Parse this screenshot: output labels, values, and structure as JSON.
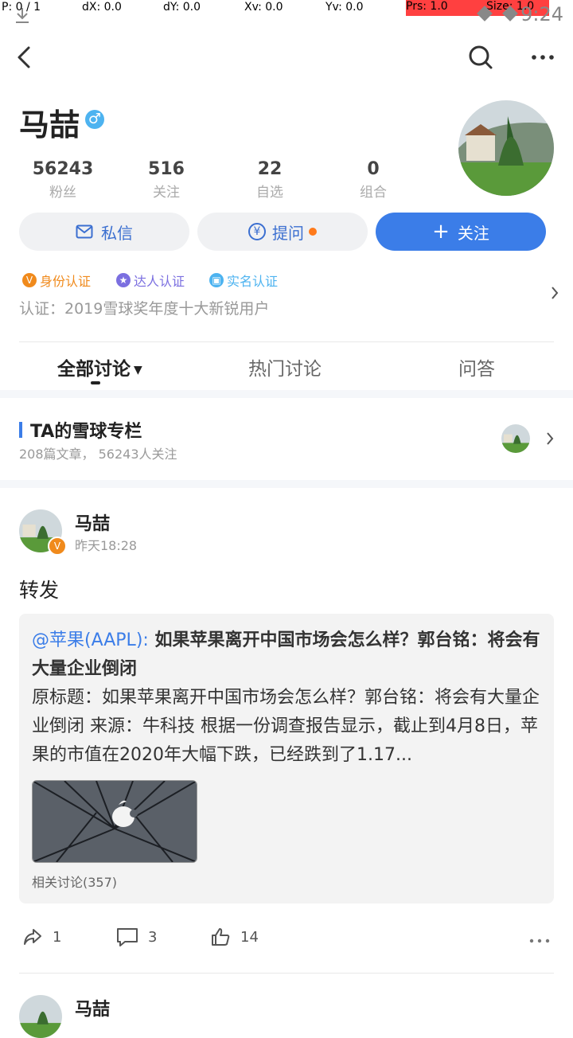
{
  "debug": {
    "p": "P: 0 / 1",
    "dx": "dX: 0.0",
    "dy": "dY: 0.0",
    "xv": "Xv: 0.0",
    "yv": "Yv: 0.0",
    "prs": "Prs: 1.0",
    "size": "Size: 1.0"
  },
  "status_bar": {
    "time": "9:24"
  },
  "profile": {
    "name": "马喆",
    "stats": [
      {
        "value": "56243",
        "label": "粉丝"
      },
      {
        "value": "516",
        "label": "关注"
      },
      {
        "value": "22",
        "label": "自选"
      },
      {
        "value": "0",
        "label": "组合"
      }
    ],
    "buttons": {
      "message": "私信",
      "ask": "提问",
      "follow": "关注"
    },
    "badges": [
      {
        "icon": "V",
        "label": "身份认证",
        "color": "#f08a1c"
      },
      {
        "icon": "★",
        "label": "达人认证",
        "color": "#7b6fe0"
      },
      {
        "icon": "▣",
        "label": "实名认证",
        "color": "#4db3f0"
      }
    ],
    "certification": "认证：2019雪球奖年度十大新锐用户"
  },
  "tabs": [
    "全部讨论",
    "热门讨论",
    "问答"
  ],
  "column": {
    "title": "TA的雪球专栏",
    "subtitle": "208篇文章， 56243人关注"
  },
  "post": {
    "author": "马喆",
    "time": "昨天18:28",
    "body": "转发",
    "quote": {
      "mention": "@苹果(AAPL):",
      "title": " 如果苹果离开中国市场会怎么样？郭台铭：将会有大量企业倒闭",
      "text": "原标题：如果苹果离开中国市场会怎么样？郭台铭：将会有大量企业倒闭 来源：牛科技 根据一份调查报告显示，截止到4月8日，苹果的市值在2020年大幅下跌，已经跌到了1.17...",
      "related": "相关讨论(357)"
    },
    "actions": {
      "repost": "1",
      "comment": "3",
      "like": "14"
    }
  },
  "next_post": {
    "author": "马喆"
  },
  "colors": {
    "accent": "#3b7de8",
    "orange": "#f08a1c"
  }
}
